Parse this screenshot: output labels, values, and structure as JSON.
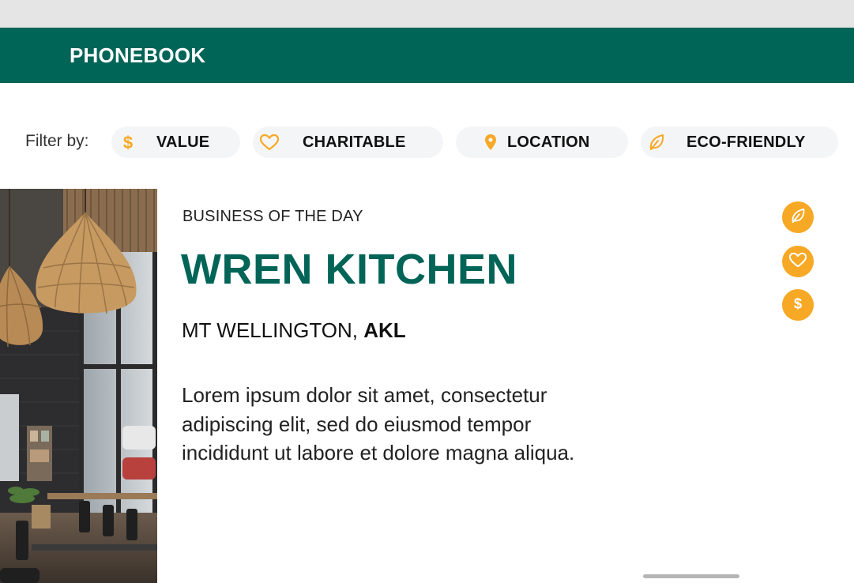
{
  "app": {
    "title": "PHONEBOOK"
  },
  "filters": {
    "label": "Filter by:",
    "items": [
      {
        "label": "VALUE",
        "icon": "dollar-icon"
      },
      {
        "label": "CHARITABLE",
        "icon": "heart-icon"
      },
      {
        "label": "LOCATION",
        "icon": "map-pin-icon"
      },
      {
        "label": "ECO-FRIENDLY",
        "icon": "leaf-icon"
      }
    ]
  },
  "feature": {
    "eyebrow": "BUSINESS OF THE DAY",
    "name": "WREN KITCHEN",
    "suburb": "MT WELLINGTON, ",
    "region": "AKL",
    "description": "Lorem ipsum dolor sit amet, consectetur adipiscing elit, sed do eiusmod tempor incididunt ut labore et dolore magna aliqua.",
    "badges": [
      "leaf-icon",
      "heart-icon",
      "dollar-icon"
    ]
  },
  "colors": {
    "brand": "#006457",
    "accent": "#f7a824",
    "chip_background": "#f4f5f7"
  }
}
